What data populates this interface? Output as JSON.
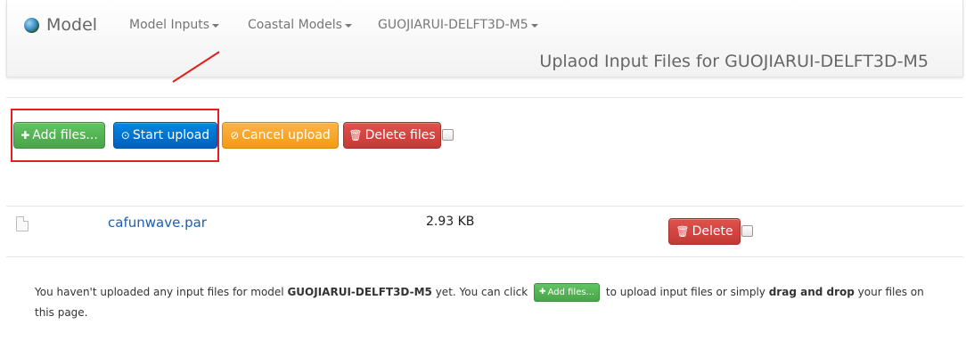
{
  "navbar": {
    "brand": "Model",
    "menus": [
      "Model Inputs",
      "Coastal Models",
      "GUOJIARUI-DELFT3D-M5"
    ],
    "heading": "Uplaod Input Files for GUOJIARUI-DELFT3D-M5"
  },
  "toolbar": {
    "add_label": "Add files...",
    "start_label": "Start upload",
    "cancel_label": "Cancel upload",
    "delete_label": "Delete files"
  },
  "files": [
    {
      "name": "cafunwave.par",
      "size": "2.93 KB",
      "delete_label": "Delete"
    }
  ],
  "note": {
    "t1": "You haven't uploaded any input files for model ",
    "model": "GUOJIARUI-DELFT3D-M5",
    "t2": " yet. You can click ",
    "button_label": "Add files...",
    "t3": " to upload input files or simply ",
    "emphasis": "drag and drop",
    "t4": " your files on this page."
  },
  "colors": {
    "green": "#5cb85c",
    "blue": "#0074cc",
    "orange": "#f89406",
    "red": "#da4f49",
    "annotation": "#e02020",
    "link": "#1a5fb4"
  },
  "icons": [
    "globe-icon",
    "plus-icon",
    "upload-icon",
    "ban-icon",
    "trash-icon",
    "file-icon"
  ]
}
